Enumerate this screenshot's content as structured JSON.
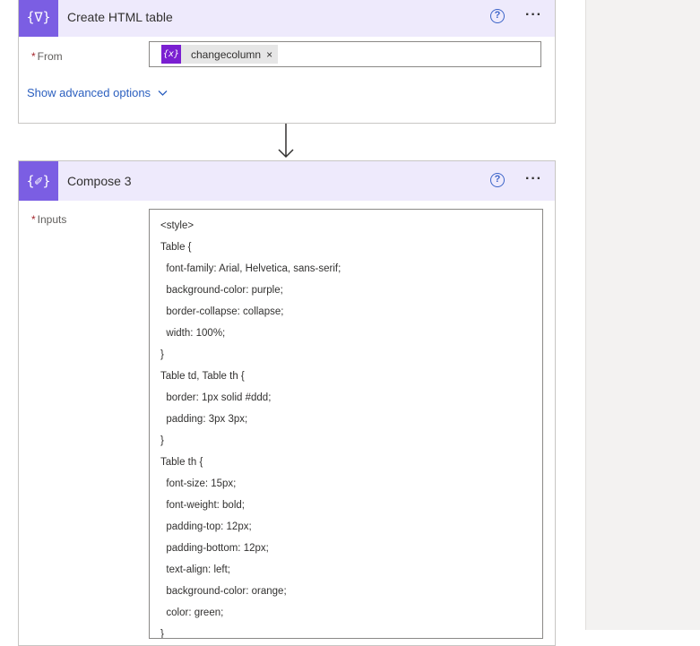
{
  "cards": [
    {
      "title": "Create HTML table",
      "icon": "html-table-icon",
      "icon_glyph": "{∇}",
      "field_label": "From",
      "required_mark": "*",
      "token": {
        "label": "changecolumn",
        "icon_glyph": "{x}",
        "remove": "×"
      },
      "advanced_link": "Show advanced options"
    },
    {
      "title": "Compose 3",
      "icon": "compose-icon",
      "icon_glyph": "{✐}",
      "field_label": "Inputs",
      "required_mark": "*",
      "code_lines": [
        "<style>",
        "Table {",
        "  font-family: Arial, Helvetica, sans-serif;",
        "  background-color: purple;",
        "  border-collapse: collapse;",
        "  width: 100%;",
        "}",
        "Table td, Table th {",
        "  border: 1px solid #ddd;",
        "  padding: 3px 3px;",
        "}",
        "Table th {",
        "  font-size: 15px;",
        "  font-weight: bold;",
        "  padding-top: 12px;",
        "  padding-bottom: 12px;",
        "  text-align: left;",
        "  background-color: orange;",
        "  color: green;",
        "}"
      ]
    }
  ],
  "header_actions": {
    "help_glyph": "?",
    "more_glyph": "···"
  },
  "colors": {
    "accent": "#7b5ee3",
    "header_bg": "#eeeafc",
    "token_icon": "#7a1fd1",
    "link": "#2b5fbf",
    "required": "#a4262c"
  }
}
